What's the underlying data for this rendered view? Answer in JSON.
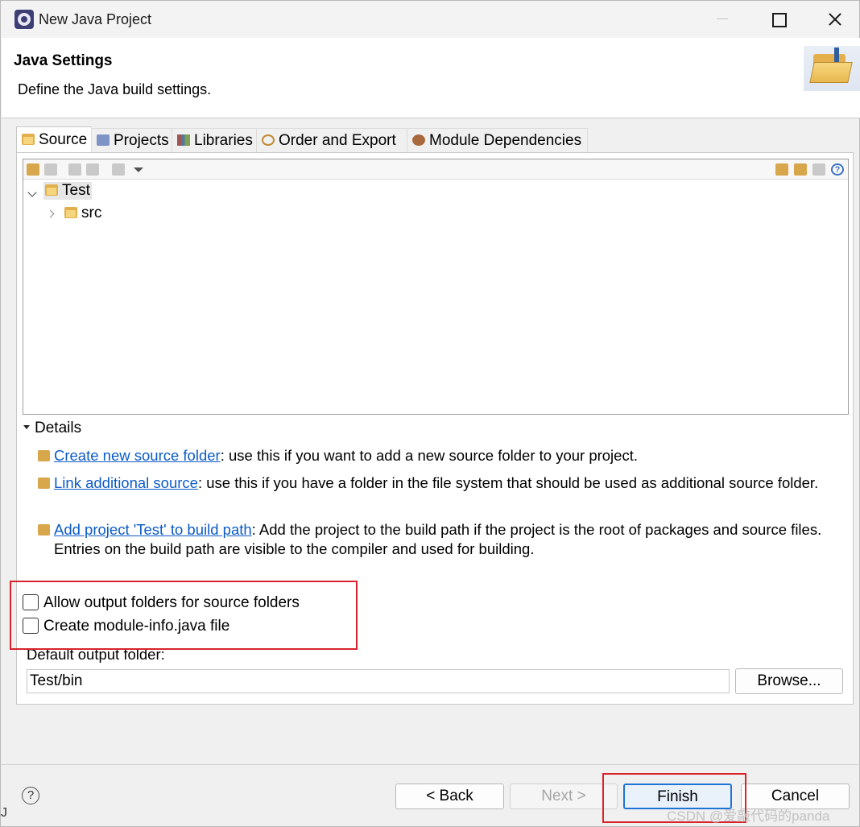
{
  "window": {
    "title": "New Java Project"
  },
  "header": {
    "title": "Java Settings",
    "description": "Define the Java build settings."
  },
  "tabs": [
    {
      "label": "Source"
    },
    {
      "label": "Projects"
    },
    {
      "label": "Libraries"
    },
    {
      "label": "Order and Export"
    },
    {
      "label": "Module Dependencies"
    }
  ],
  "tree": {
    "root": "Test",
    "child": "src"
  },
  "details": {
    "label": "Details",
    "items": [
      {
        "link": "Create new source folder",
        "text": ": use this if you want to add a new source folder to your project."
      },
      {
        "link": "Link additional source",
        "text": ": use this if you have a folder in the file system that should be used as additional source folder."
      },
      {
        "link": "Add project 'Test' to build path",
        "text": ": Add the project to the build path if the project is the root of packages and source files. Entries on the build path are visible to the compiler and used for building."
      }
    ]
  },
  "options": {
    "allow_output_folders": "Allow output folders for source folders",
    "create_module_info": "Create module-info.java file"
  },
  "output": {
    "label": "Default output folder:",
    "value": "Test/bin",
    "browse": "Browse..."
  },
  "buttons": {
    "help": "?",
    "back": "< Back",
    "next": "Next >",
    "finish": "Finish",
    "cancel": "Cancel"
  },
  "watermark": "CSDN @爱敲代码的panda",
  "edge_text": "J"
}
